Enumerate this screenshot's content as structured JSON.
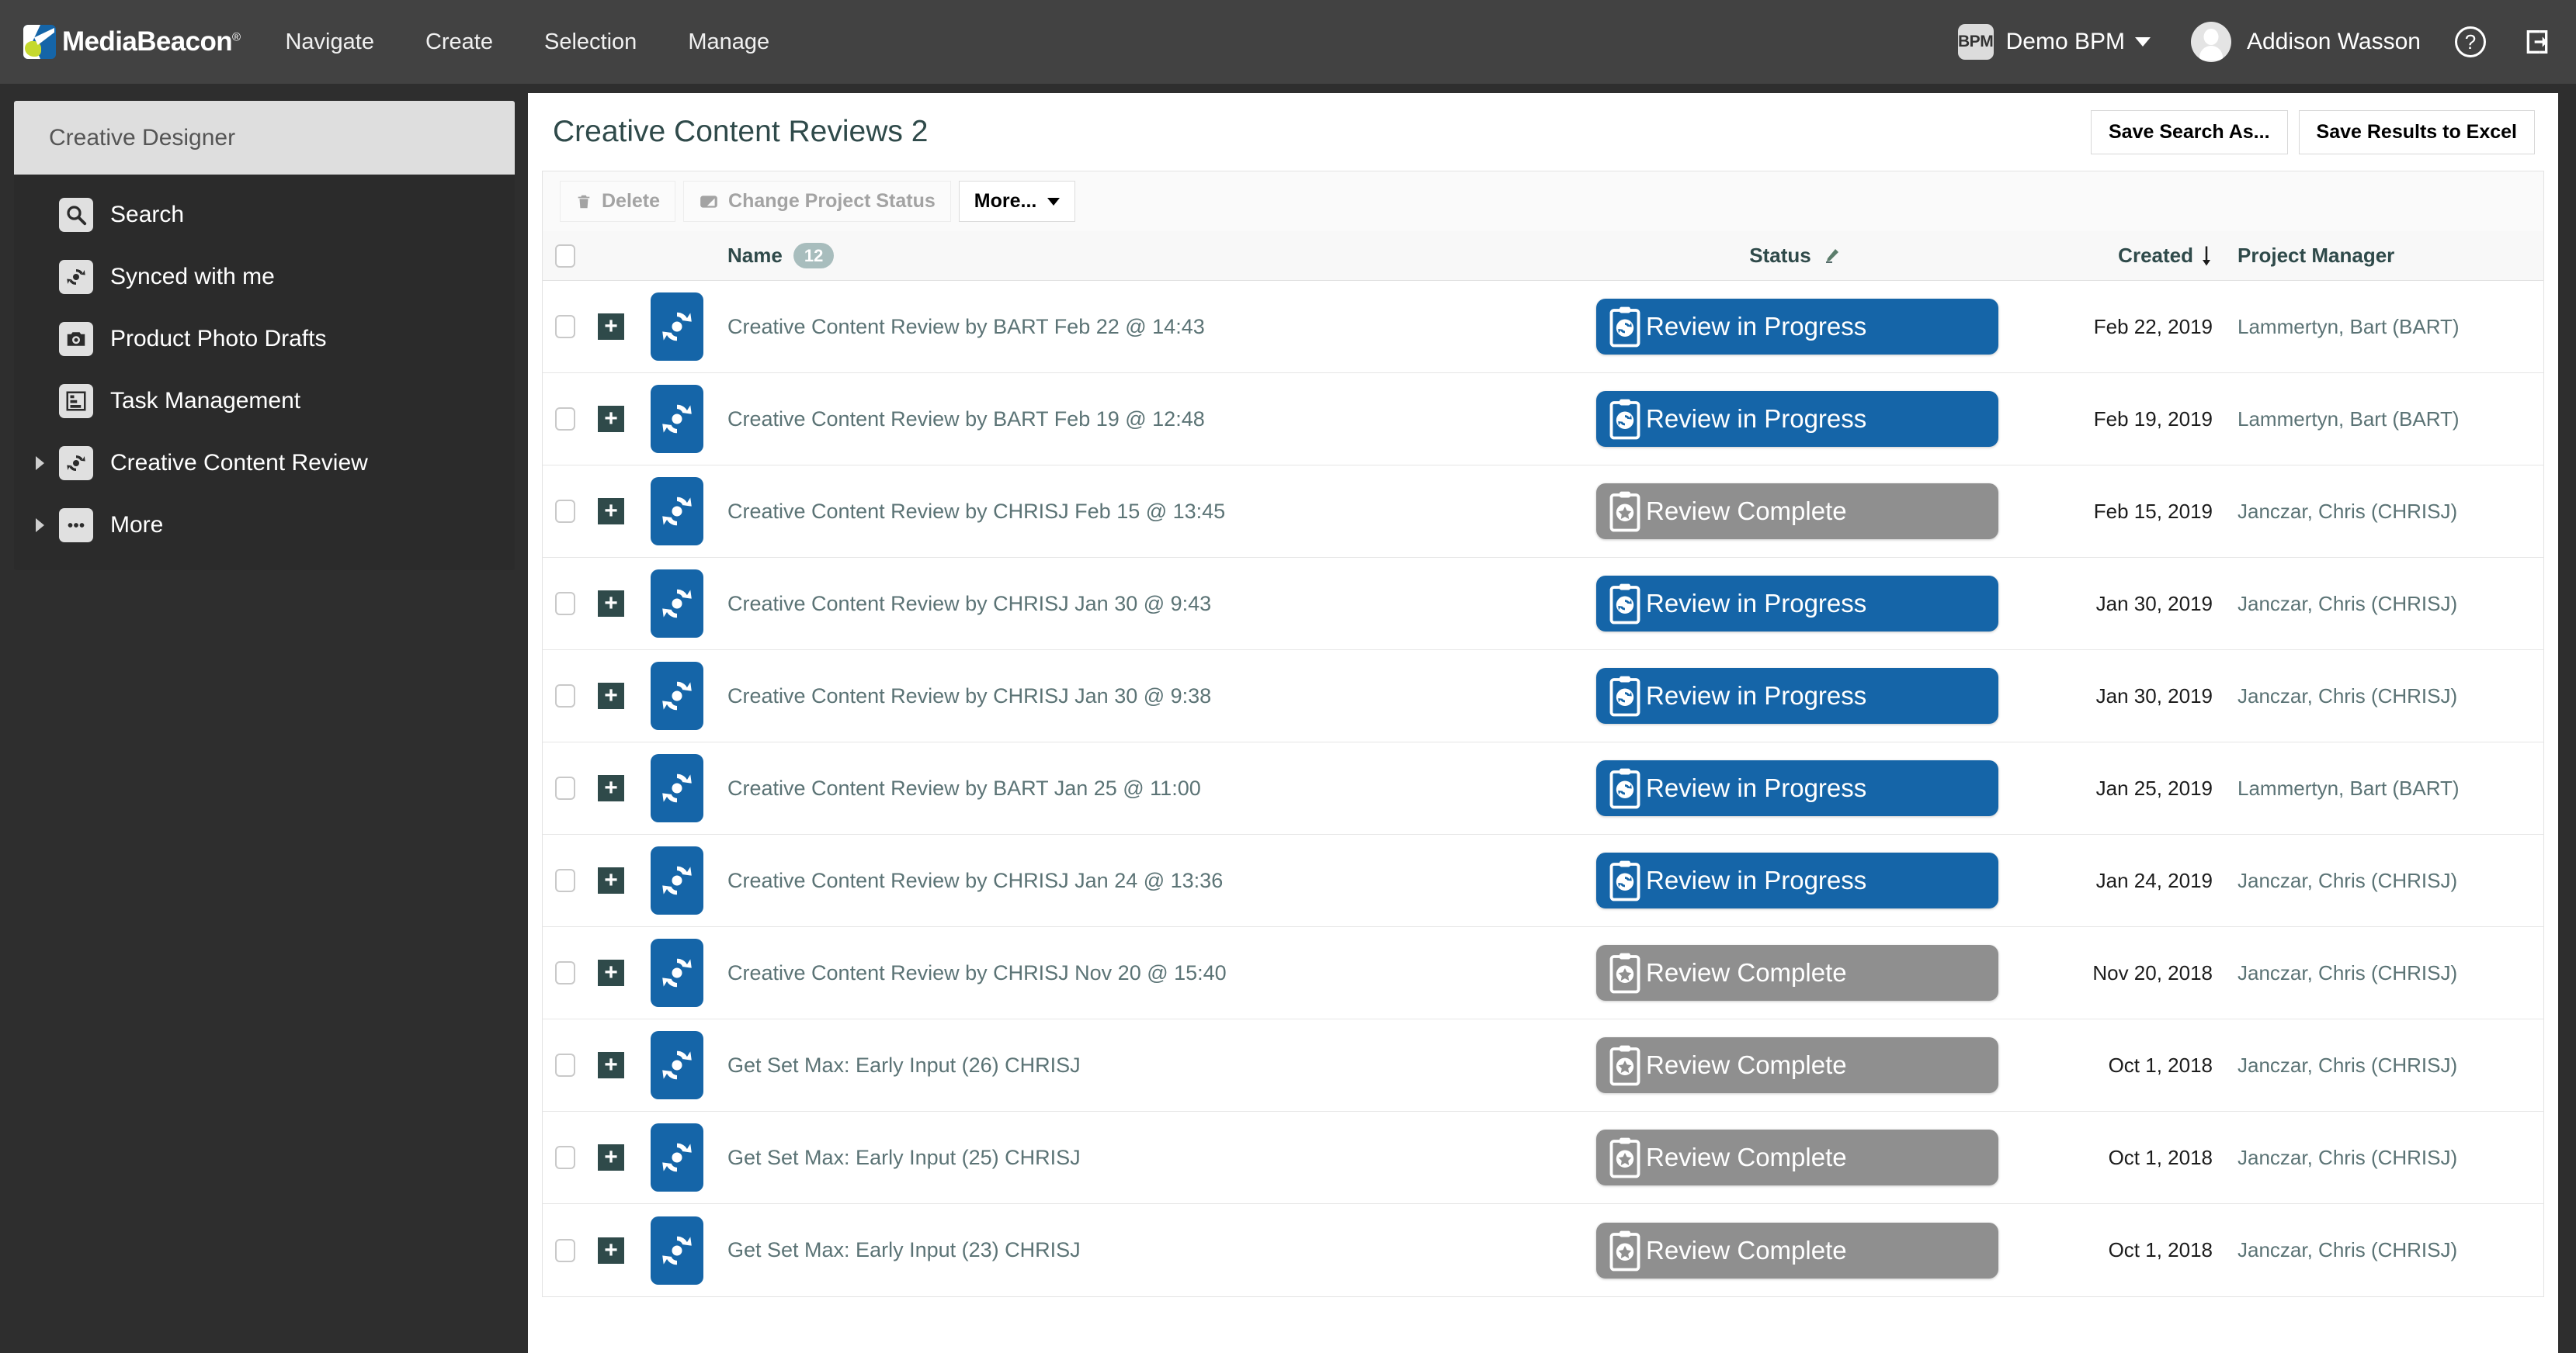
{
  "topbar": {
    "brand": "MediaBeacon",
    "brand_mark": "registered-trademark",
    "menu": [
      "Navigate",
      "Create",
      "Selection",
      "Manage"
    ],
    "workspace_badge": "BPM",
    "workspace_label": "Demo BPM",
    "user_name": "Addison Wasson",
    "help_icon": "help-question-icon",
    "logout_icon": "logout-icon",
    "colors": {
      "bar": "#424242",
      "badge_bg": "#dcdcdc",
      "text": "#ffffff"
    }
  },
  "sidebar": {
    "header": "Creative Designer",
    "items": [
      {
        "label": "Search",
        "icon": "search-icon",
        "expandable": false
      },
      {
        "label": "Synced with me",
        "icon": "sync-icon",
        "expandable": false
      },
      {
        "label": "Product Photo Drafts",
        "icon": "camera-icon",
        "expandable": false
      },
      {
        "label": "Task Management",
        "icon": "task-chart-icon",
        "expandable": false
      },
      {
        "label": "Creative Content Review",
        "icon": "sync-icon",
        "expandable": true
      },
      {
        "label": "More",
        "icon": "ellipsis-icon",
        "expandable": true
      }
    ]
  },
  "main": {
    "title": "Creative Content Reviews 2",
    "header_buttons": [
      {
        "label": "Save Search As...",
        "name": "save-search-as-button"
      },
      {
        "label": "Save Results to Excel",
        "name": "save-results-to-excel-button"
      }
    ],
    "toolbar": [
      {
        "label": "Delete",
        "icon": "trash-icon",
        "enabled": false,
        "dropdown": false
      },
      {
        "label": "Change Project Status",
        "icon": "status-square-icon",
        "enabled": false,
        "dropdown": false
      },
      {
        "label": "More...",
        "icon": "",
        "enabled": true,
        "dropdown": true
      }
    ],
    "table": {
      "columns": {
        "name": "Name",
        "name_count": "12",
        "status": "Status",
        "status_icon": "pencil-edit-icon",
        "created": "Created",
        "sort_icon": "sort-descending-arrow-icon",
        "project_manager": "Project Manager"
      },
      "status_colors": {
        "Review in Progress": "#1565a8",
        "Review Complete": "#8f8f8f"
      },
      "rows": [
        {
          "name": "Creative Content Review by BART Feb 22 @ 14:43",
          "status": "Review in Progress",
          "status_icon": "clipboard-refresh-icon",
          "created": "Feb 22, 2019",
          "project_manager": "Lammertyn, Bart (BART)"
        },
        {
          "name": "Creative Content Review by BART Feb 19 @ 12:48",
          "status": "Review in Progress",
          "status_icon": "clipboard-refresh-icon",
          "created": "Feb 19, 2019",
          "project_manager": "Lammertyn, Bart (BART)"
        },
        {
          "name": "Creative Content Review by CHRISJ Feb 15 @ 13:45",
          "status": "Review Complete",
          "status_icon": "clipboard-star-icon",
          "created": "Feb 15, 2019",
          "project_manager": "Janczar, Chris (CHRISJ)"
        },
        {
          "name": "Creative Content Review by CHRISJ Jan 30 @ 9:43",
          "status": "Review in Progress",
          "status_icon": "clipboard-refresh-icon",
          "created": "Jan 30, 2019",
          "project_manager": "Janczar, Chris (CHRISJ)"
        },
        {
          "name": "Creative Content Review by CHRISJ Jan 30 @ 9:38",
          "status": "Review in Progress",
          "status_icon": "clipboard-refresh-icon",
          "created": "Jan 30, 2019",
          "project_manager": "Janczar, Chris (CHRISJ)"
        },
        {
          "name": "Creative Content Review by BART Jan 25 @ 11:00",
          "status": "Review in Progress",
          "status_icon": "clipboard-refresh-icon",
          "created": "Jan 25, 2019",
          "project_manager": "Lammertyn, Bart (BART)"
        },
        {
          "name": "Creative Content Review by CHRISJ Jan 24 @ 13:36",
          "status": "Review in Progress",
          "status_icon": "clipboard-refresh-icon",
          "created": "Jan 24, 2019",
          "project_manager": "Janczar, Chris (CHRISJ)"
        },
        {
          "name": "Creative Content Review by CHRISJ Nov 20 @ 15:40",
          "status": "Review Complete",
          "status_icon": "clipboard-star-icon",
          "created": "Nov 20, 2018",
          "project_manager": "Janczar, Chris (CHRISJ)"
        },
        {
          "name": "Get Set Max: Early Input (26) CHRISJ",
          "status": "Review Complete",
          "status_icon": "clipboard-star-icon",
          "created": "Oct 1, 2018",
          "project_manager": "Janczar, Chris (CHRISJ)"
        },
        {
          "name": "Get Set Max: Early Input (25) CHRISJ",
          "status": "Review Complete",
          "status_icon": "clipboard-star-icon",
          "created": "Oct 1, 2018",
          "project_manager": "Janczar, Chris (CHRISJ)"
        },
        {
          "name": "Get Set Max: Early Input (23) CHRISJ",
          "status": "Review Complete",
          "status_icon": "clipboard-star-icon",
          "created": "Oct 1, 2018",
          "project_manager": "Janczar, Chris (CHRISJ)"
        }
      ]
    }
  }
}
